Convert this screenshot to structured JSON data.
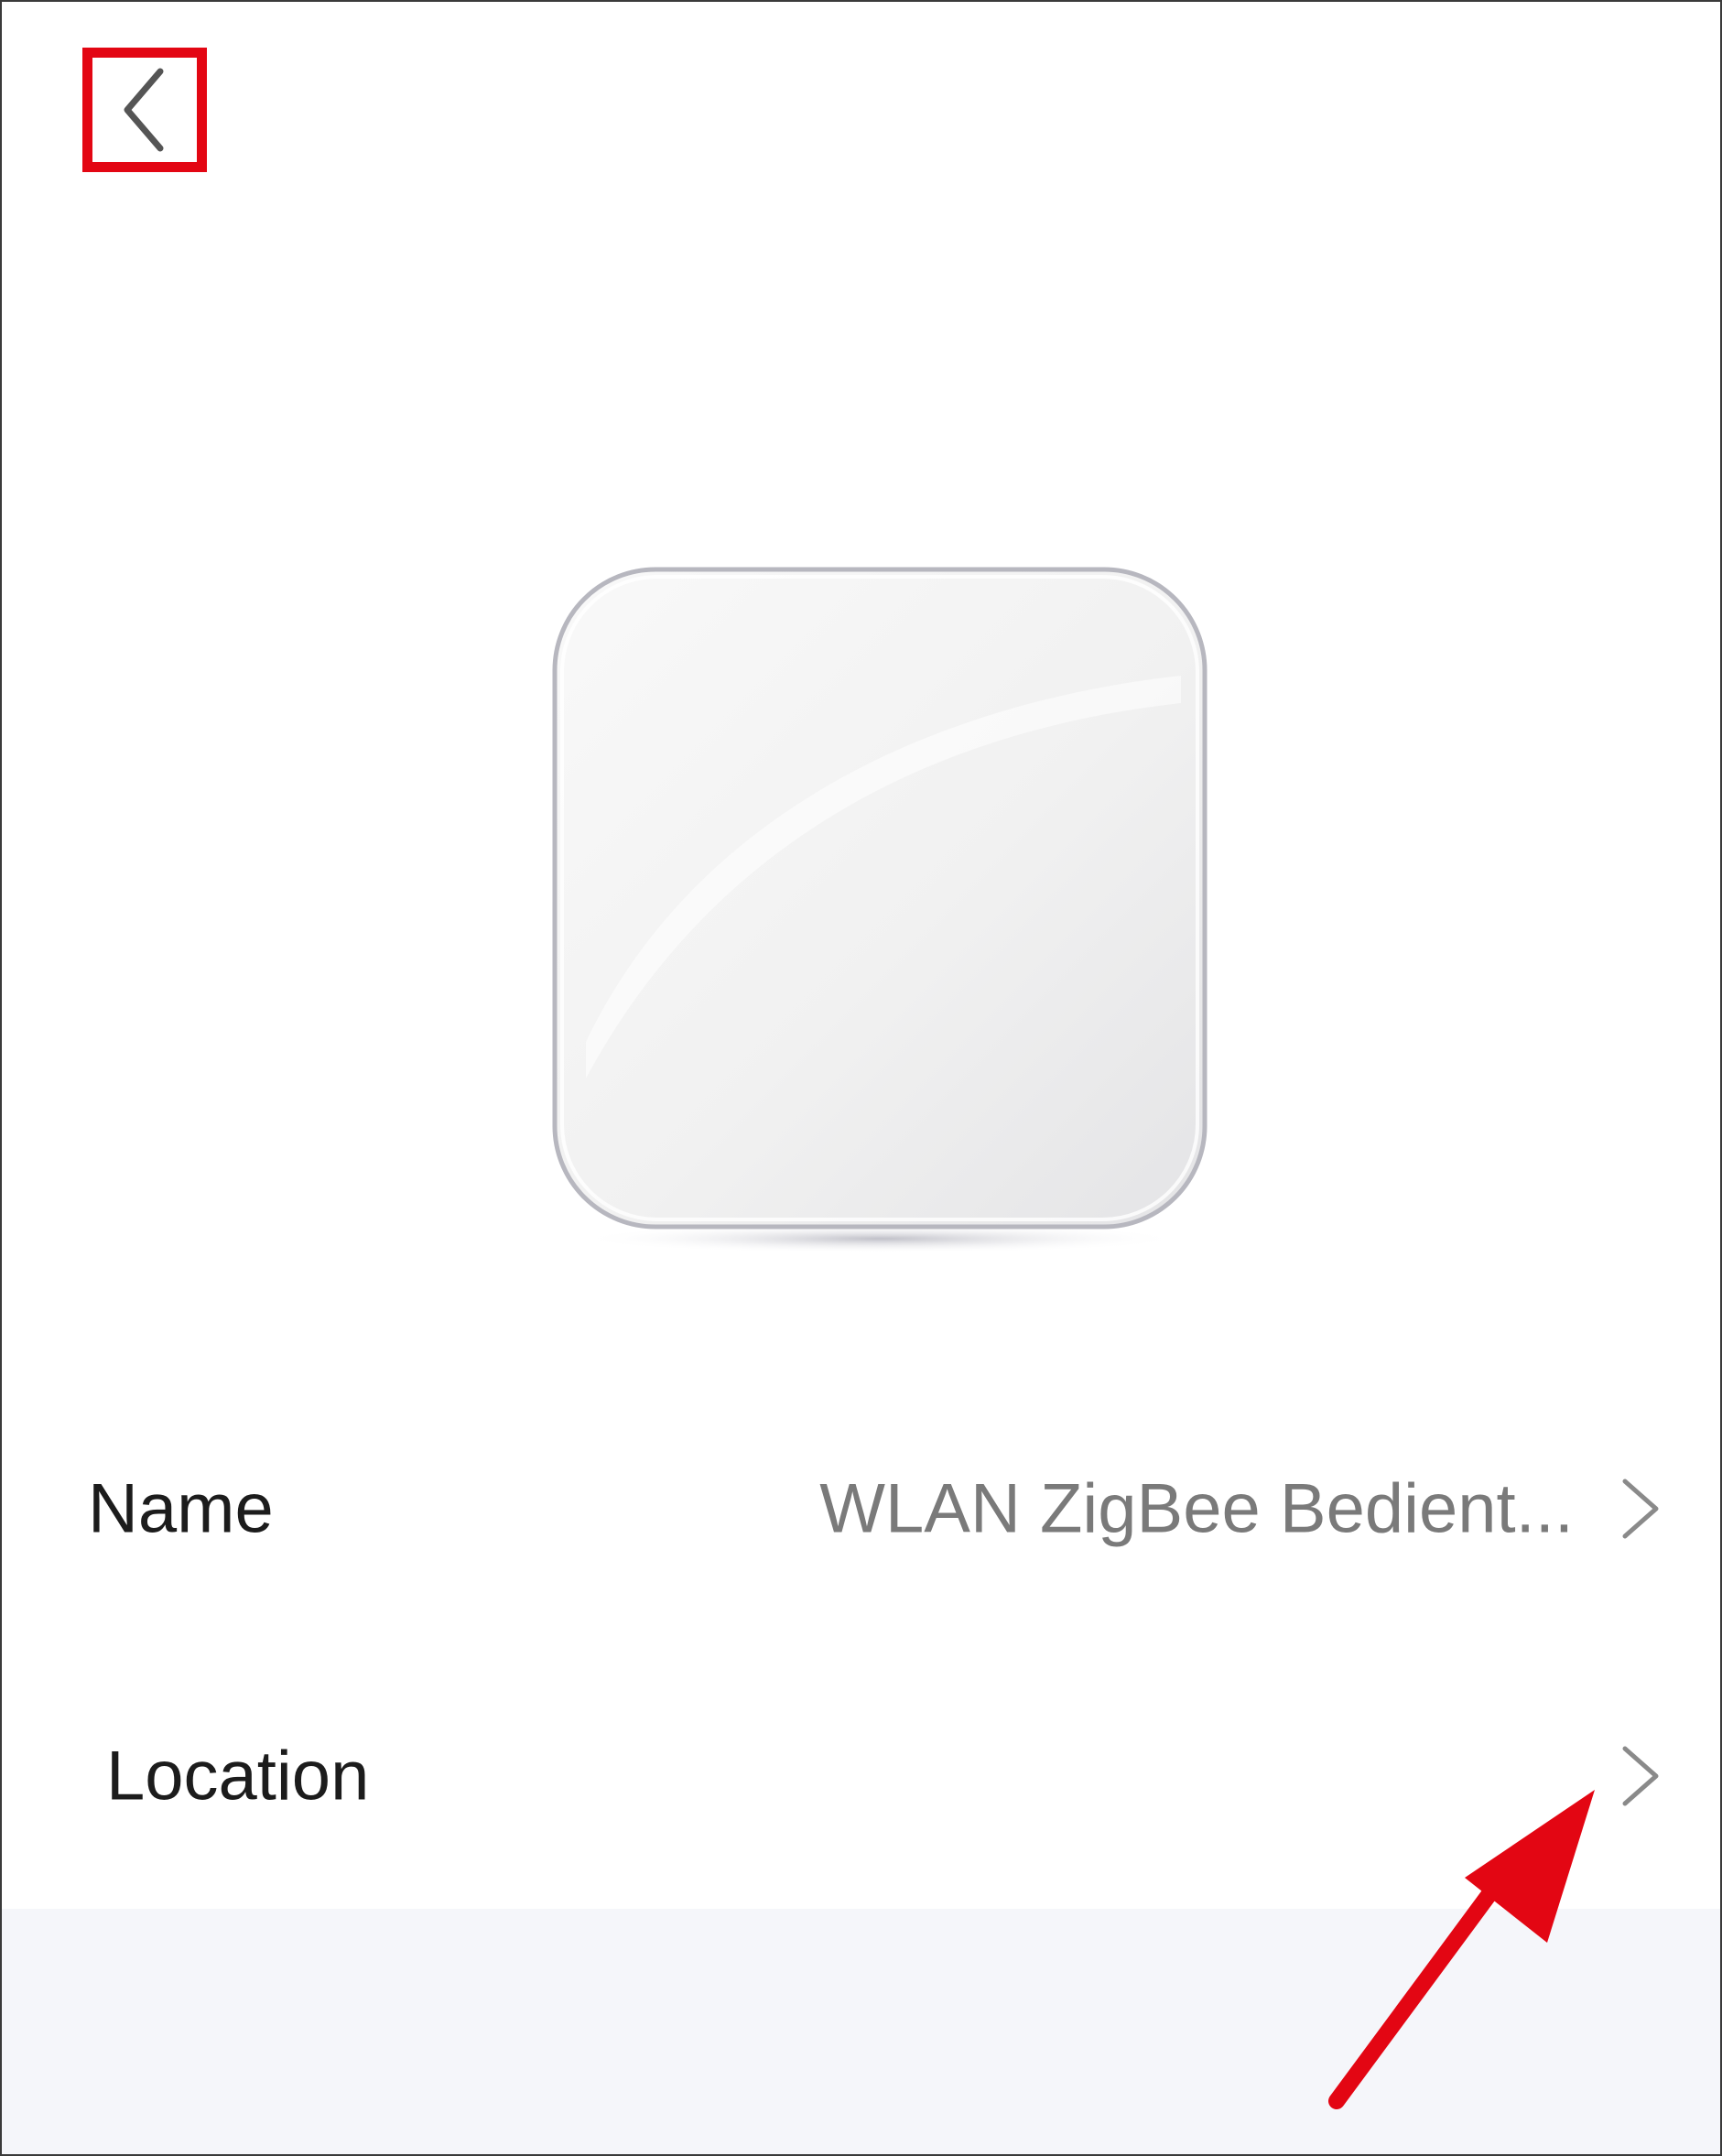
{
  "header": {
    "back_icon": "chevron-left-icon",
    "highlight_color": "#e30613"
  },
  "device": {
    "image_icon": "rounded-square-device-icon"
  },
  "rows": {
    "name": {
      "label": "Name",
      "value": "WLAN ZigBee Bedient...",
      "chevron_icon": "chevron-right-icon"
    },
    "location": {
      "label": "Location",
      "chevron_icon": "chevron-right-icon"
    }
  },
  "annotation": {
    "arrow_icon": "red-arrow-icon",
    "arrow_color": "#e30613"
  },
  "colors": {
    "background": "#ffffff",
    "bottom_panel": "#f5f6fa",
    "label_text": "#1c1c1c",
    "value_text": "#7a7a7a"
  }
}
